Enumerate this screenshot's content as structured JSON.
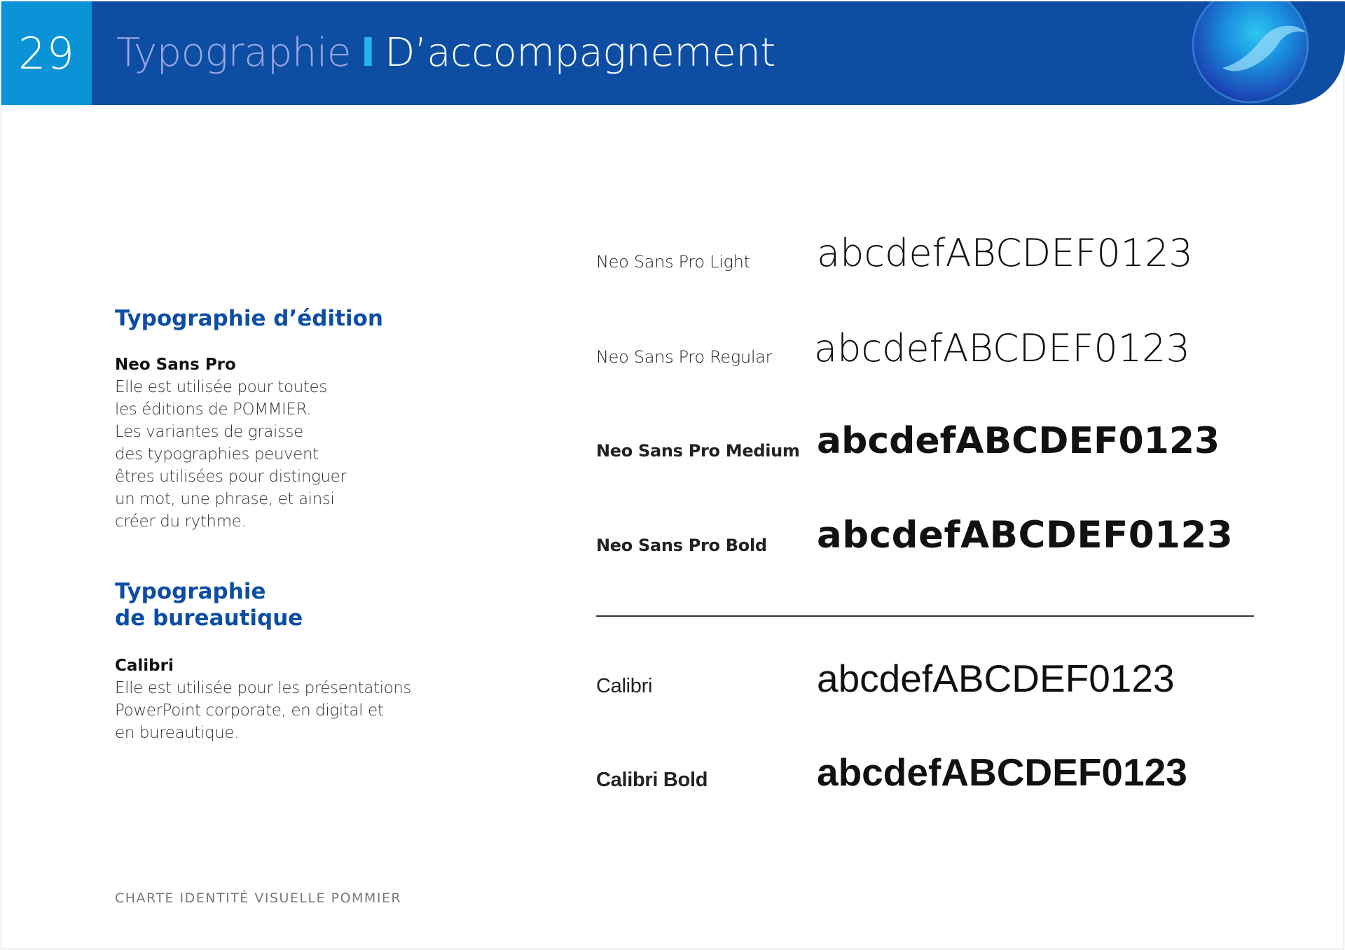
{
  "header": {
    "page_number": "29",
    "title": "Typographie",
    "separator": "I",
    "subtitle": "D’accompagnement",
    "colors": {
      "band": "#0d4ea3",
      "number_box": "#0a93d6",
      "title": "#9aa6e2",
      "separator": "#27b4ec"
    },
    "logo_icon": "pommier-orb-icon"
  },
  "edition": {
    "heading": "Typographie d’édition",
    "font_name": "Neo Sans Pro",
    "description_lines": [
      "Elle est utilisée pour toutes",
      "les éditions de POMMIER.",
      "Les variantes de graisse",
      "des typographies peuvent",
      "êtres utilisées pour distinguer",
      "un mot, une phrase, et ainsi",
      "créer du rythme."
    ]
  },
  "office": {
    "heading_line1": "Typographie",
    "heading_line2": "de bureautique",
    "font_name": "Calibri",
    "description_lines": [
      "Elle est utilisée pour les présentations",
      "PowerPoint corporate, en digital et",
      "en bureautique."
    ]
  },
  "specimens": [
    {
      "label": "Neo Sans Pro Light",
      "sample": "abcdefABCDEF0123"
    },
    {
      "label": "Neo Sans Pro Regular",
      "sample": "abcdefABCDEF0123"
    },
    {
      "label": "Neo Sans Pro Medium",
      "sample": "abcdefABCDEF0123"
    },
    {
      "label": "Neo Sans Pro Bold",
      "sample": "abcdefABCDEF0123"
    },
    {
      "label": "Calibri",
      "sample": "abcdefABCDEF0123"
    },
    {
      "label": "Calibri Bold",
      "sample": "abcdefABCDEF0123"
    }
  ],
  "footer": {
    "text": "CHARTE IDENTITÉ VISUELLE POMMIER"
  }
}
